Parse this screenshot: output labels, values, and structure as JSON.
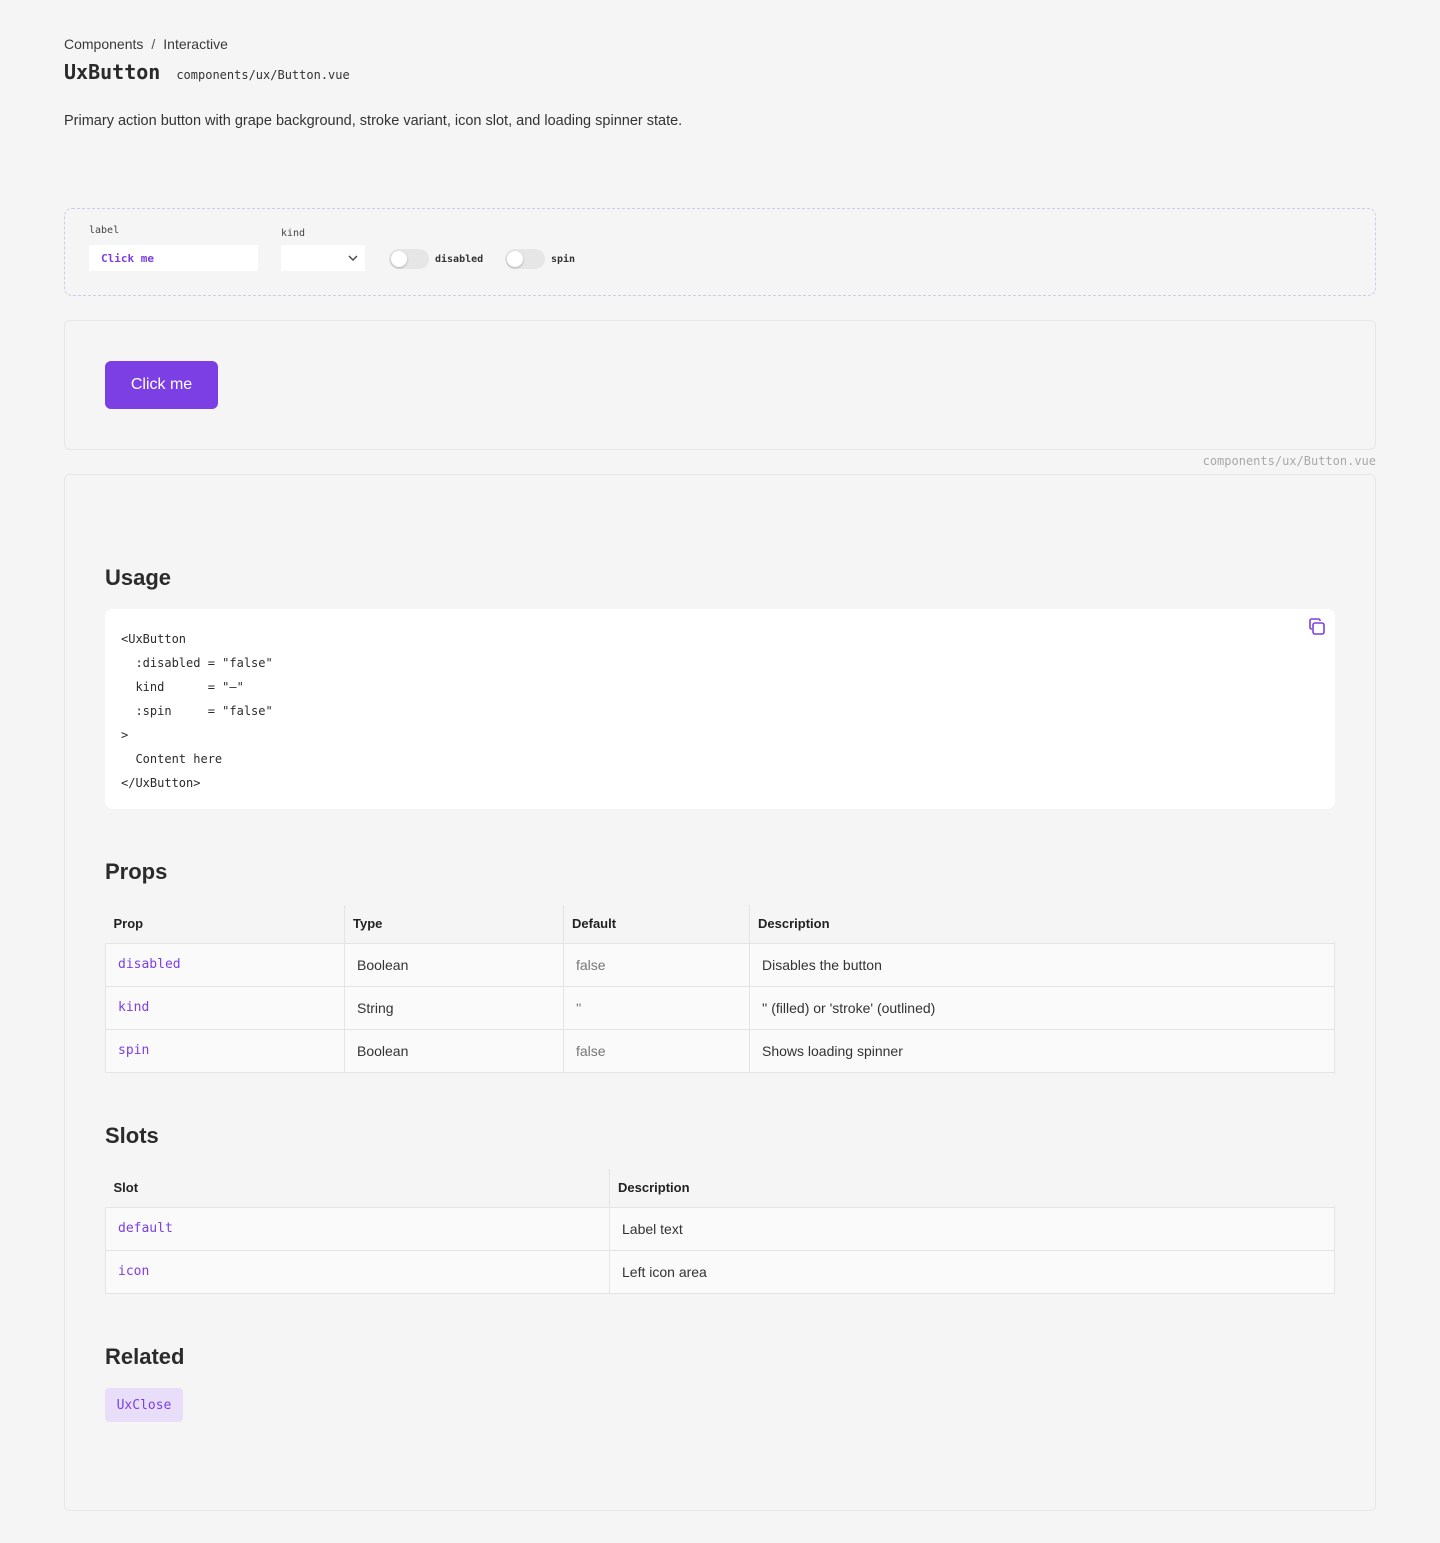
{
  "breadcrumb": {
    "parent": "Components",
    "separator": "/",
    "current": "Interactive"
  },
  "header": {
    "title": "UxButton",
    "file_path": "components/ux/Button.vue"
  },
  "description": "Primary action button with grape background, stroke variant, icon slot, and loading spinner state.",
  "controls": {
    "label_caption": "label",
    "label_value": "Click me",
    "kind_caption": "kind",
    "kind_value": "",
    "toggles": [
      {
        "label": "disabled",
        "on": false
      },
      {
        "label": "spin",
        "on": false
      }
    ]
  },
  "preview": {
    "button_label": "Click me",
    "file_caption": "components/ux/Button.vue"
  },
  "colors": {
    "accent": "#7b3fe4",
    "chip_bg": "#e8def9",
    "page_bg": "#f5f5f5"
  },
  "sections": {
    "usage": "Usage",
    "props": "Props",
    "slots": "Slots",
    "related": "Related"
  },
  "usage_code": "<UxButton\n  :disabled = \"false\"\n  kind      = \"—\"\n  :spin     = \"false\"\n>\n  Content here\n</UxButton>",
  "props_table": {
    "headers": [
      "Prop",
      "Type",
      "Default",
      "Description"
    ],
    "rows": [
      [
        "disabled",
        "Boolean",
        "false",
        "Disables the button"
      ],
      [
        "kind",
        "String",
        "''",
        "'' (filled) or 'stroke' (outlined)"
      ],
      [
        "spin",
        "Boolean",
        "false",
        "Shows loading spinner"
      ]
    ]
  },
  "slots_table": {
    "headers": [
      "Slot",
      "Description"
    ],
    "rows": [
      [
        "default",
        "Label text"
      ],
      [
        "icon",
        "Left icon area"
      ]
    ]
  },
  "related": [
    "UxClose"
  ],
  "icons": {
    "copy": "copy-icon",
    "select_arrow": "chevron-down-icon"
  }
}
